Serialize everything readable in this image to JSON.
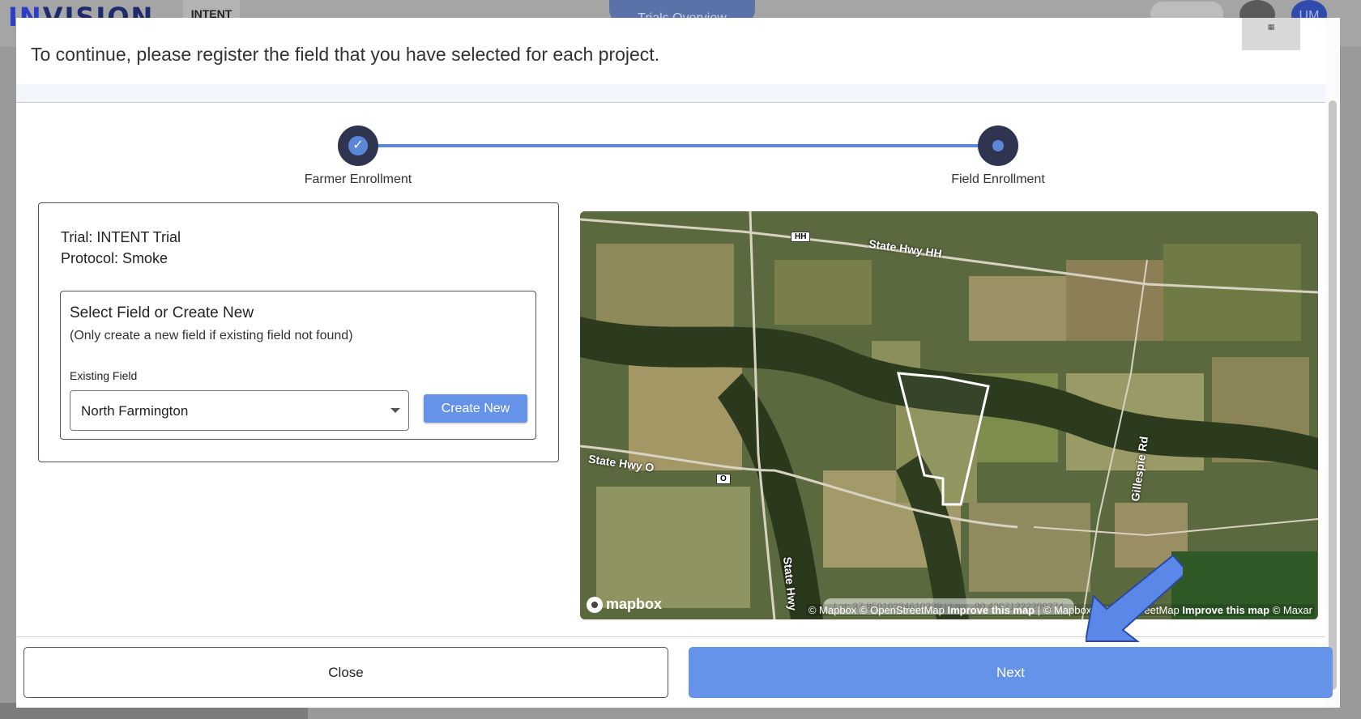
{
  "background": {
    "logo_text_accent": "IN",
    "logo_text_rest": "VISION",
    "brand": "INTENT",
    "tab_label": "Trials Overview",
    "avatar_initials": "UM"
  },
  "modal": {
    "title": "To continue, please register the field that you have selected for each project."
  },
  "stepper": {
    "steps": [
      {
        "label": "Farmer Enrollment",
        "state": "done"
      },
      {
        "label": "Field Enrollment",
        "state": "active"
      }
    ]
  },
  "card": {
    "trial": "Trial: INTENT Trial",
    "protocol": "Protocol: Smoke",
    "select_title": "Select Field or Create New",
    "select_subtitle": "(Only create a new field if existing field not found)",
    "field_label": "Existing Field",
    "field_value": "North Farmington",
    "create_button": "Create New"
  },
  "map": {
    "roads": {
      "hwy_hh": "State Hwy HH",
      "hwy_o": "State Hwy O",
      "gillespie": "Gillespie Rd",
      "hwy_vertical": "State Hwy"
    },
    "shields": {
      "hh": "HH",
      "o": "O"
    },
    "coords": "Lat: 37.85010284610239 | Lng: -90.43071222299274",
    "attribution_1": "© Mapbox © OpenStreetMap",
    "improve_1": "Improve this map",
    "attribution_2": "| © Mapbox © OpenStreetMap",
    "improve_2": "Improve this map",
    "attribution_3": "© Maxar",
    "logo": "mapbox"
  },
  "footer": {
    "close_label": "Close",
    "next_label": "Next"
  },
  "colors": {
    "accent": "#6593e9",
    "step_dark": "#2f3550",
    "arrow": "#5b87e8"
  }
}
